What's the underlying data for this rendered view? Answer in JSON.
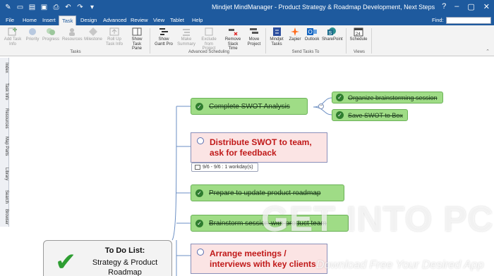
{
  "app": {
    "title": "Mindjet MindManager - Product Strategy & Roadmap Development, Next Steps"
  },
  "tabs": [
    "File",
    "Home",
    "Insert",
    "Task",
    "Design",
    "Advanced",
    "Review",
    "View",
    "Tablet",
    "Help"
  ],
  "active_tab": "Task",
  "find": {
    "label": "Find:"
  },
  "ribbon": {
    "buttons": [
      {
        "label": "Add Task Info",
        "icon": "add-task-icon"
      },
      {
        "label": "Priority",
        "icon": "priority-icon"
      },
      {
        "label": "Progress",
        "icon": "progress-icon"
      },
      {
        "label": "Resources",
        "icon": "resources-icon"
      },
      {
        "label": "Milestone",
        "icon": "milestone-icon"
      },
      {
        "label": "Roll Up Task Info",
        "icon": "rollup-icon"
      },
      {
        "label": "Show Task Pane",
        "icon": "task-pane-icon"
      },
      {
        "label": "Show Gantt Pro",
        "icon": "gantt-icon"
      },
      {
        "label": "Make Summary",
        "icon": "summary-icon"
      },
      {
        "label": "Exclude from Project",
        "icon": "exclude-icon"
      },
      {
        "label": "Remove Slack Time",
        "icon": "slack-icon"
      },
      {
        "label": "Move Project",
        "icon": "move-icon"
      },
      {
        "label": "Mindjet Tasks",
        "icon": "mindjet-tasks-icon"
      },
      {
        "label": "Zapier",
        "icon": "zapier-icon"
      },
      {
        "label": "Outlook",
        "icon": "outlook-icon"
      },
      {
        "label": "SharePoint",
        "icon": "sharepoint-icon"
      },
      {
        "label": "Schedule",
        "icon": "calendar-icon"
      }
    ],
    "groups": [
      "Tasks",
      "Advanced Scheduling",
      "Send Tasks To",
      "Views"
    ]
  },
  "sidebar": [
    "Index",
    "Task Info",
    "Resources",
    "Map Parts",
    "Library",
    "Search",
    "Browser"
  ],
  "central": {
    "title": "To Do List:",
    "subtitle": "Strategy & Product Roadmap"
  },
  "topics": {
    "swot": "Complete SWOT Analysis",
    "organize": "Organize brainstorming session",
    "save_swot": "Save SWOT to Box",
    "distribute": "Distribute SWOT to team, ask for feedback",
    "distribute_sched": "9/6 - 9/6 : 1 workday(s)",
    "prepare": "Prepare to update product roadmap",
    "brainstorm": "Brainstorm session with product team",
    "arrange": "Arrange meetings / interviews with key clients"
  },
  "watermark": {
    "text": "GET INTO PC",
    "sub": "Download Free Your Desired App"
  },
  "colors": {
    "title_bar": "#1e5a9e",
    "done_topic": "#9fdc86",
    "todo_topic": "#fbe4e4",
    "todo_text": "#c01818"
  }
}
